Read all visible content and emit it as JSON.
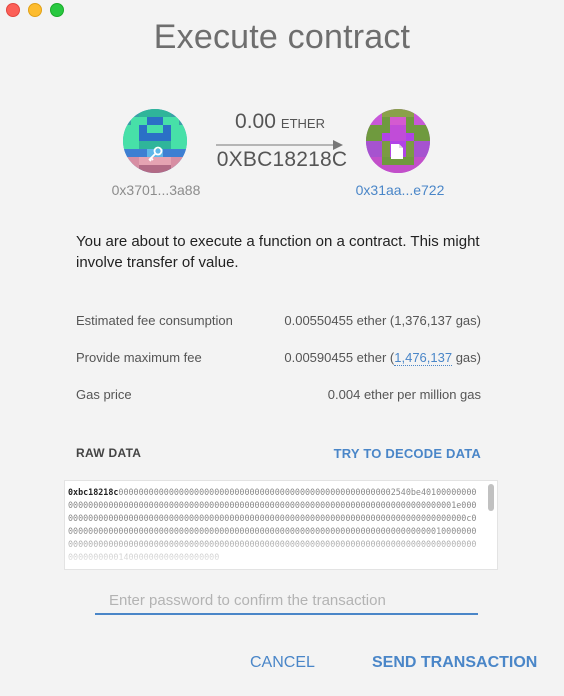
{
  "window": {
    "title": "Execute contract"
  },
  "transfer": {
    "amount": "0.00",
    "unit": "ETHER",
    "recipient_name": "0XBC18218C",
    "from_address": "0x3701...3a88",
    "to_address": "0x31aa...e722",
    "from_identicon_icon": "key-icon",
    "to_identicon_icon": "document-icon"
  },
  "description": "You are about to execute a function on a contract. This might involve transfer of value.",
  "fees": {
    "estimated_label": "Estimated fee consumption",
    "estimated_ether": "0.00550455 ether (",
    "estimated_gas": "1,376,137",
    "estimated_gas_unit": " gas)",
    "max_label": "Provide maximum fee",
    "max_ether": "0.00590455 ether (",
    "max_gas": "1,476,137",
    "max_gas_unit": " gas)",
    "gas_price_label": "Gas price",
    "gas_price_value": "0.004 ether per million gas"
  },
  "raw_data": {
    "label": "RAW DATA",
    "decode_label": "TRY TO DECODE DATA",
    "method_id": "0xbc18218c",
    "rest": "0000000000000000000000000000000000000000000000000000002540be4010000000000000000000000000000000000000000000000000000000000000000000000000000000000001e0000000000000000000000000000000000000000000000000000000000000000000000000000000000c0000000000000000000000000000000000000000000000000000000000000000000000000010000000000000000000000000000000000000000000000000000000000000000000000000000000000000000000000000014000000000000000000"
  },
  "password": {
    "placeholder": "Enter password to confirm the transaction",
    "value": ""
  },
  "actions": {
    "cancel": "CANCEL",
    "send": "SEND TRANSACTION"
  },
  "colors": {
    "accent": "#4a86c8",
    "background": "#f3f3f3"
  }
}
